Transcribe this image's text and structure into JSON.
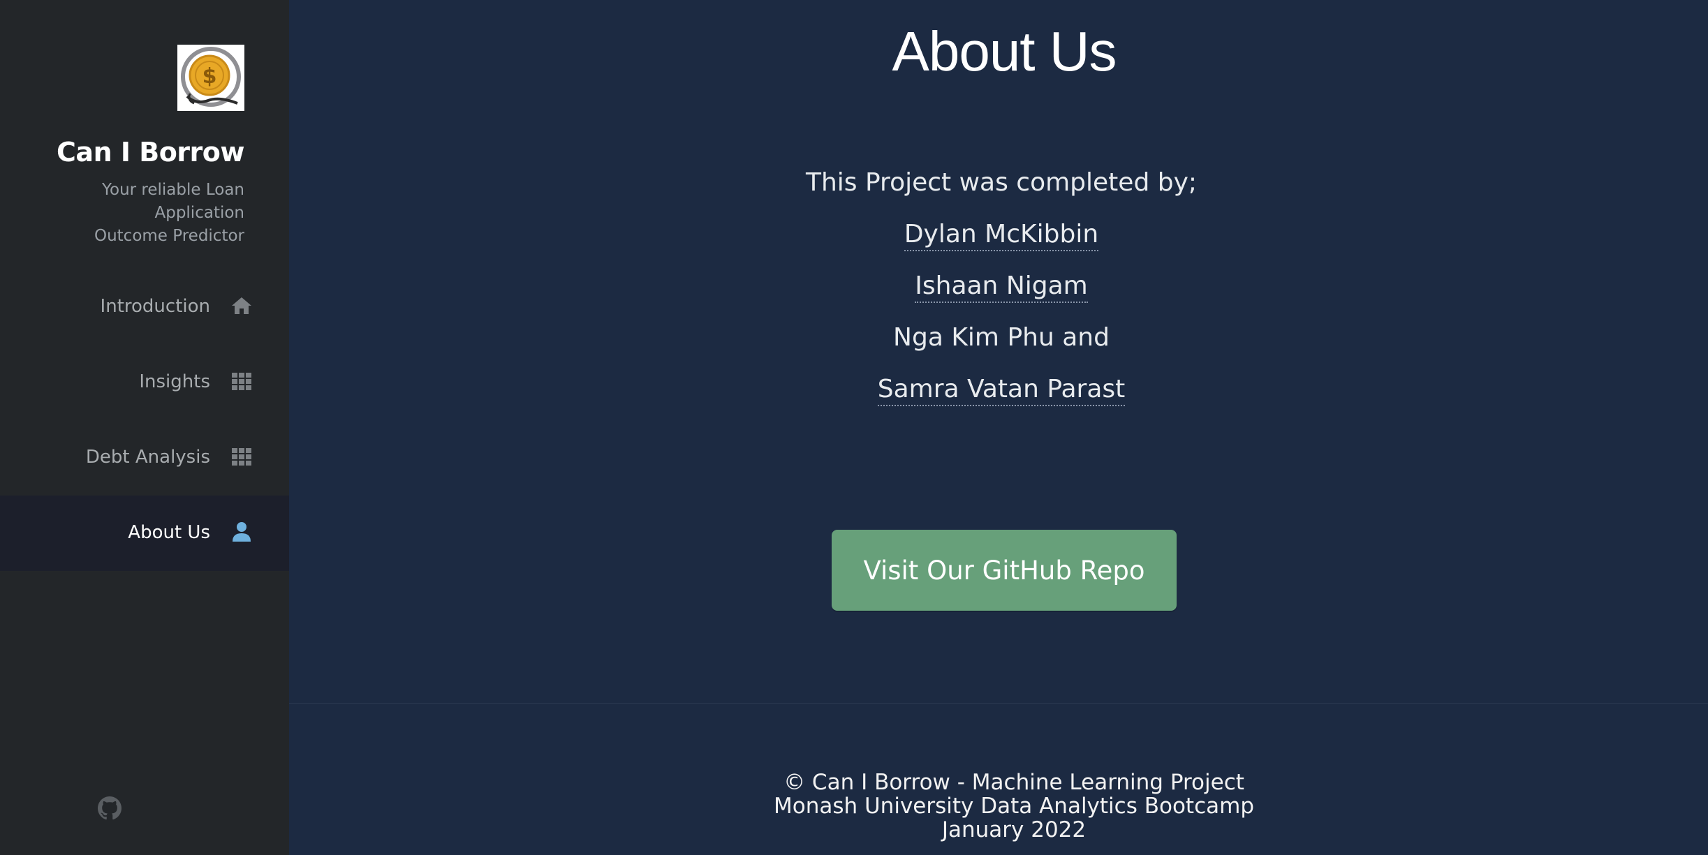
{
  "sidebar": {
    "logo_icon": "coin-dollar-logo-icon",
    "brand_title": "Can I Borrow",
    "brand_subtitle_line1": "Your reliable Loan Application",
    "brand_subtitle_line2": "Outcome Predictor",
    "nav": [
      {
        "label": "Introduction",
        "icon": "home-icon",
        "active": false
      },
      {
        "label": "Insights",
        "icon": "grid-icon",
        "active": false
      },
      {
        "label": "Debt Analysis",
        "icon": "grid-icon",
        "active": false
      },
      {
        "label": "About Us",
        "icon": "user-icon",
        "active": true
      }
    ],
    "footer_icon": "github-icon"
  },
  "main": {
    "title": "About Us",
    "intro": "This Project was completed by;",
    "members": [
      {
        "name": "Dylan McKibbin",
        "is_link": true
      },
      {
        "name": "Ishaan Nigam",
        "is_link": true
      },
      {
        "name": "Nga Kim Phu and",
        "is_link": false
      },
      {
        "name": "Samra Vatan Parast",
        "is_link": true
      }
    ],
    "github_button_label": "Visit Our GitHub Repo"
  },
  "footer": {
    "line1": "© Can I Borrow - Machine Learning Project",
    "line2": "Monash University Data Analytics Bootcamp",
    "line3": "January 2022"
  },
  "colors": {
    "main_background": "#1c2a42",
    "sidebar_background": "#232629",
    "active_nav_background": "#1c1f2b",
    "active_icon": "#6fb1de",
    "button_green": "#67a07a"
  }
}
